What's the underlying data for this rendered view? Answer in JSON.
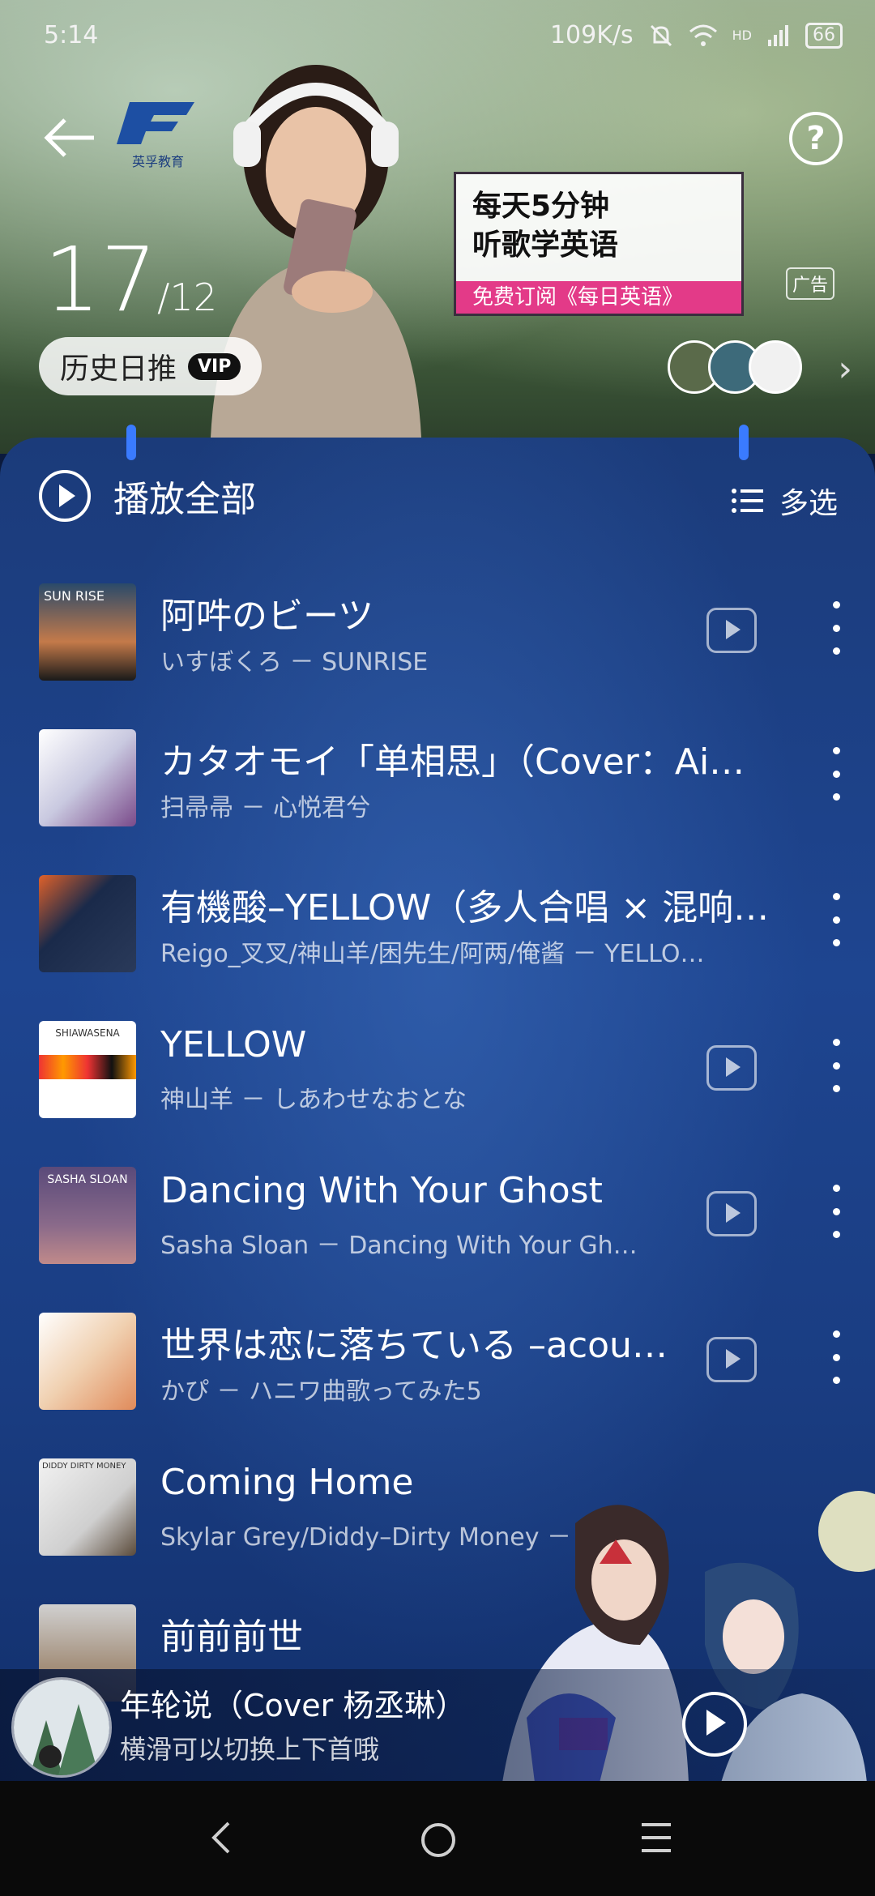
{
  "status_bar": {
    "time": "5:14",
    "net_speed": "109K/s",
    "network": "4G",
    "hd": "HD",
    "battery": "66"
  },
  "header": {
    "brand_sub": "英孚教育",
    "date_day": "17",
    "date_month": "/12",
    "history_label": "历史日推",
    "vip_label": "VIP",
    "help": "?",
    "chevron": "›"
  },
  "ad": {
    "line1": "每天5分钟",
    "line2": "听歌学英语",
    "cta": "免费订阅《每日英语》",
    "tag": "广告"
  },
  "toolbar": {
    "play_all": "播放全部",
    "multi_select": "多选"
  },
  "songs": [
    {
      "title": "阿吽のビーツ",
      "subtitle": "いすぼくろ － SUNRISE",
      "cover_text": "SUN RISE"
    },
    {
      "title": "カタオモイ「单相思」（Cover：Ai…",
      "subtitle": "扫帚帚 － 心悦君兮",
      "cover_text": ""
    },
    {
      "title": "有機酸–YELLOW（多人合唱 × 混响…",
      "subtitle": "Reigo_叉叉/神山羊/困先生/阿两/俺酱 － YELLO…",
      "cover_text": ""
    },
    {
      "title": "YELLOW",
      "subtitle": "神山羊 － しあわせなおとな",
      "cover_text": "SHIAWASENA"
    },
    {
      "title": "Dancing With Your Ghost",
      "subtitle": "Sasha Sloan － Dancing With Your Gh…",
      "cover_text": "SASHA SLOAN"
    },
    {
      "title": "世界は恋に落ちている –acou…",
      "subtitle": "かぴ － ハニワ曲歌ってみた5",
      "cover_text": ""
    },
    {
      "title": "Coming Home",
      "subtitle": "Skylar Grey/Diddy–Dirty Money －",
      "cover_text": "DIDDY DIRTY MONEY"
    },
    {
      "title": "前前前世",
      "subtitle": "",
      "cover_text": ""
    }
  ],
  "mini_player": {
    "title": "年轮说（Cover 杨丞琳）",
    "subtitle": "横滑可以切换上下首哦"
  },
  "colors": {
    "accent_pink": "#e33a88",
    "panel_blue": "#1e4590",
    "handle_blue": "#3a7bff"
  }
}
